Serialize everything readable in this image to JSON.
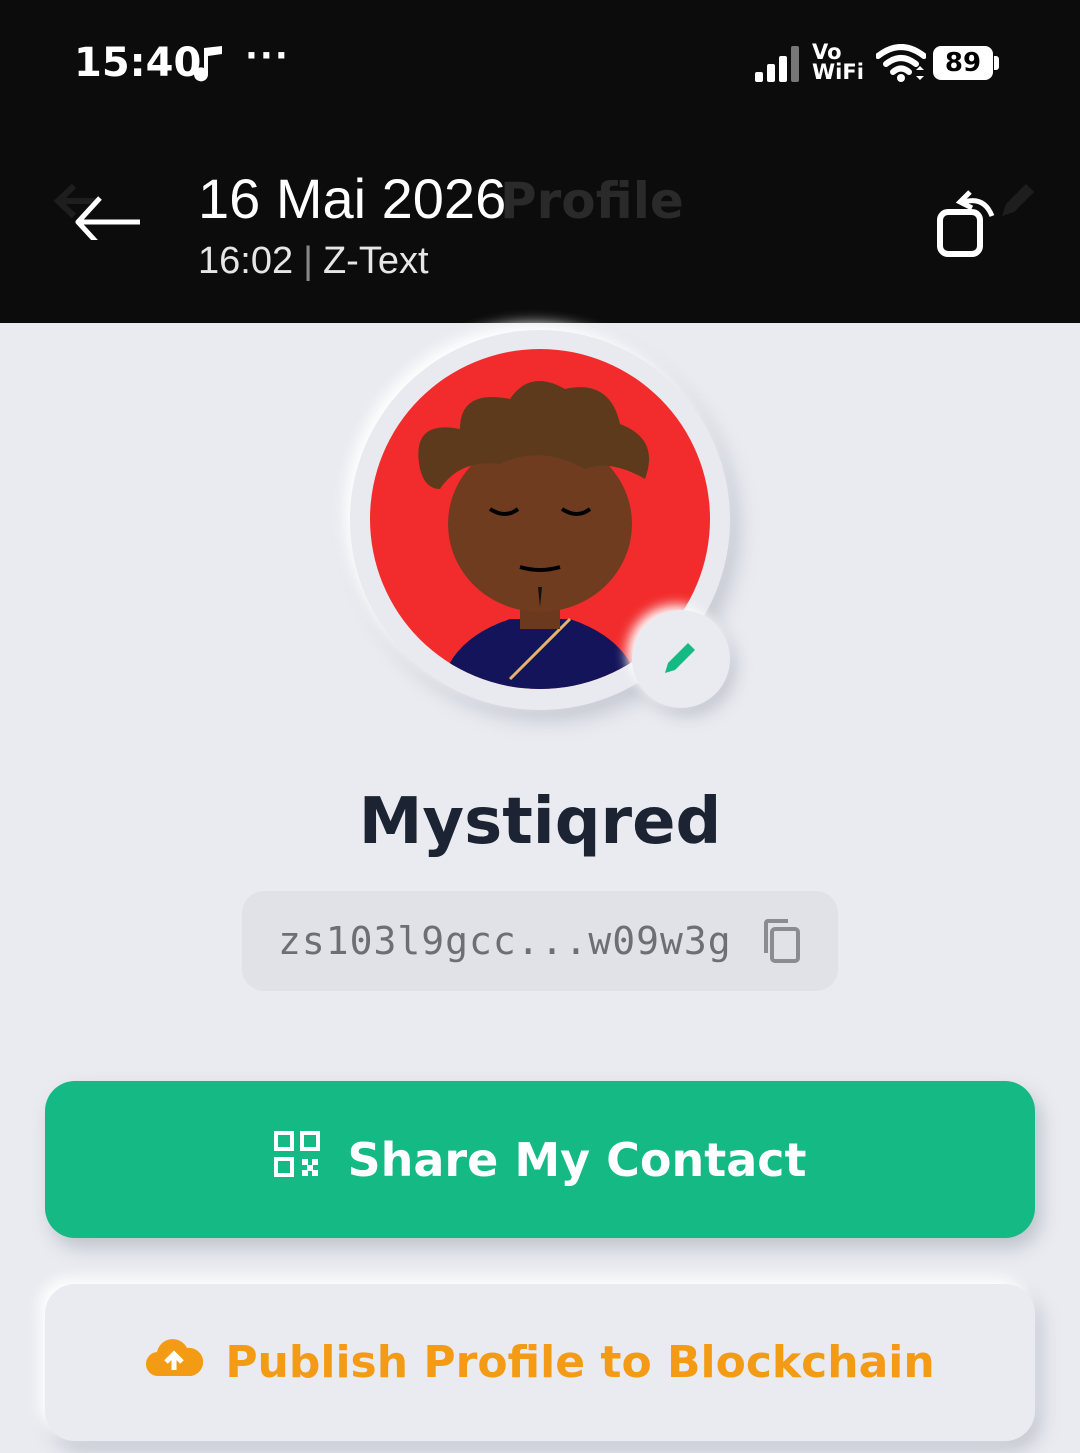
{
  "status_bar": {
    "time": "15:40",
    "dots": "···",
    "network": "Vo\nWiFi",
    "battery": "89"
  },
  "app_bar": {
    "title": "Profile"
  },
  "overlay": {
    "date": "16 Mai 2026",
    "time": "16:02",
    "app": "Z-Text"
  },
  "profile": {
    "name": "Mystiqred",
    "address": "zs103l9gcc...w09w3g"
  },
  "buttons": {
    "share": "Share My Contact",
    "publish": "Publish Profile to Blockchain"
  },
  "colors": {
    "accent_green": "#14b983",
    "accent_orange": "#f39b14",
    "avatar_bg": "#f22c2c"
  },
  "icons": [
    "music-note-icon",
    "signal-icon",
    "wifi-icon",
    "back-arrow-icon",
    "rotate-screen-icon",
    "pencil-icon",
    "copy-icon",
    "qr-code-icon",
    "cloud-upload-icon"
  ]
}
